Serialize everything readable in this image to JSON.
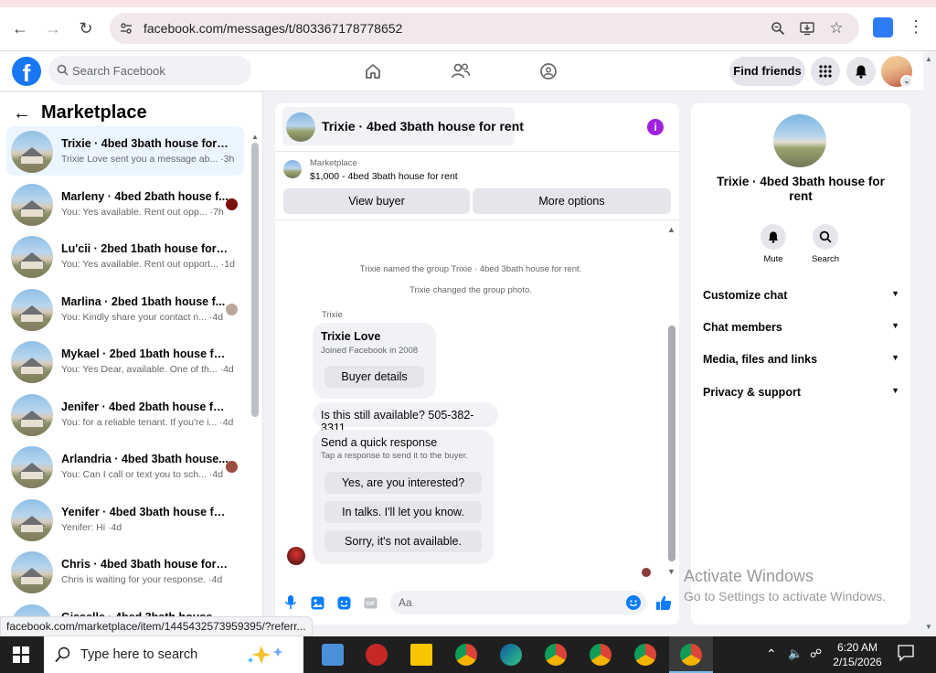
{
  "browser": {
    "url": "facebook.com/messages/t/803367178778652",
    "status_url": "facebook.com/marketplace/item/1445432573959395/?referr..."
  },
  "fb": {
    "logo": "f",
    "search_placeholder": "Search Facebook",
    "find_friends": "Find friends"
  },
  "left": {
    "title": "Marketplace",
    "threads": [
      {
        "name": "Trixie · 4bed 3bath house for rent",
        "preview": "Trixie Love sent you a message ab... ·3h",
        "active": true
      },
      {
        "name": "Marleny · 4bed 2bath house f...",
        "preview": "You: Yes available. Rent out opp... ·7h"
      },
      {
        "name": "Lu'cii · 2bed 1bath house for rent",
        "preview": "You: Yes available. Rent out opport... ·1d"
      },
      {
        "name": "Marlina · 2bed 1bath house f...",
        "preview": "You: Kindly share your contact n... ·4d"
      },
      {
        "name": "Mykael · 2bed 1bath house for r...",
        "preview": "You: Yes Dear, available. One of th... ·4d"
      },
      {
        "name": "Jenifer · 4bed 2bath house for r...",
        "preview": "You: for a reliable tenant. If you're i... ·4d"
      },
      {
        "name": "Arlandria · 4bed 3bath house...",
        "preview": "You: Can I call or text you to sch... ·4d"
      },
      {
        "name": "Yenifer · 4bed 3bath house for r...",
        "preview": "Yenifer: Hi ·4d"
      },
      {
        "name": "Chris · 4bed 3bath house for rent",
        "preview": "Chris is waiting for your response. ·4d"
      },
      {
        "name": "Gisselle · 4bed 3bath house fo...",
        "preview": ""
      }
    ]
  },
  "chat": {
    "title": "Trixie · 4bed 3bath house for rent",
    "listing_label": "Marketplace",
    "listing_price": "$1,000 - 4bed 3bath house for rent",
    "view_buyer": "View buyer",
    "more_options": "More options",
    "sys1": "Trixie named the group Trixie · 4bed 3bath house for rent.",
    "sys2": "Trixie changed the group photo.",
    "sender": "Trixie",
    "card_title": "Trixie Love",
    "card_sub": "Joined Facebook in 2008",
    "buyer_details": "Buyer details",
    "message": "Is this still available? 505-382-3311",
    "quick_title": "Send a quick response",
    "quick_sub": "Tap a response to send it to the buyer.",
    "quick_1": "Yes, are you interested?",
    "quick_2": "In talks. I'll let you know.",
    "quick_3": "Sorry, it's not available.",
    "composer_placeholder": "Aa"
  },
  "right": {
    "name": "Trixie · 4bed 3bath house for rent",
    "mute": "Mute",
    "search": "Search",
    "rows": [
      "Customize chat",
      "Chat members",
      "Media, files and links",
      "Privacy & support"
    ]
  },
  "watermark": {
    "line1": "Activate Windows",
    "line2": "Go to Settings to activate Windows."
  },
  "taskbar": {
    "search_placeholder": "Type here to search",
    "time": "6:20 AM",
    "date": "2/15/2026"
  }
}
